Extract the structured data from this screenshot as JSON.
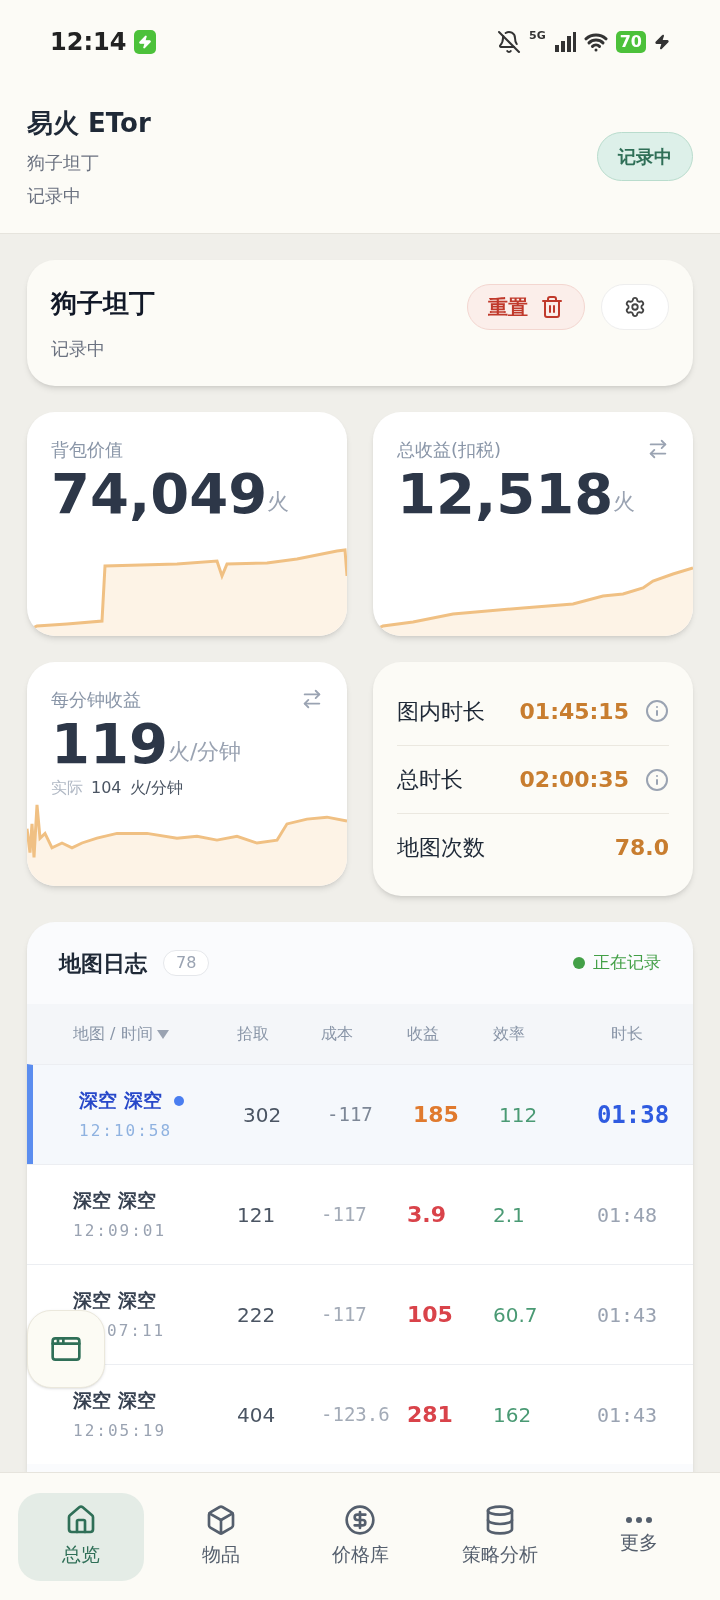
{
  "status_bar": {
    "time": "12:14",
    "network": "5G",
    "battery": "70"
  },
  "header": {
    "title": "易火 ETor",
    "subtitle": "狗子坦丁",
    "status": "记录中",
    "badge": "记录中"
  },
  "session": {
    "name": "狗子坦丁",
    "status": "记录中",
    "reset_button": "重置"
  },
  "stats": [
    {
      "kind": "sparkline",
      "label": "背包价值",
      "value": "74,049",
      "unit": "火",
      "swap": false
    },
    {
      "kind": "sparkline",
      "label": "总收益(扣税)",
      "value": "12,518",
      "unit": "火",
      "swap": true
    },
    {
      "kind": "rate",
      "label": "每分钟收益",
      "value": "119",
      "unit": "火/分钟",
      "swap": true,
      "actual_label": "实际",
      "actual_value": "104",
      "actual_unit": "火/分钟"
    }
  ],
  "times": [
    {
      "label": "图内时长",
      "value": "01:45:15",
      "info": true
    },
    {
      "label": "总时长",
      "value": "02:00:35",
      "info": true
    },
    {
      "label": "地图次数",
      "value": "78.0",
      "info": false
    }
  ],
  "map_log": {
    "title": "地图日志",
    "count": "78",
    "recording": "正在记录",
    "columns": [
      "地图 / 时间",
      "拾取",
      "成本",
      "收益",
      "效率",
      "时长"
    ],
    "rows": [
      {
        "map": "深空 深空",
        "time": "12:10:58",
        "covered": false,
        "pickup": "302",
        "cost": "-117",
        "income": "185",
        "efficiency": "112",
        "duration": "01:38",
        "selected": true
      },
      {
        "map": "深空 深空",
        "time": "12:09:01",
        "covered": false,
        "pickup": "121",
        "cost": "-117",
        "income": "3.9",
        "efficiency": "2.1",
        "duration": "01:48",
        "selected": false
      },
      {
        "map": "深空 深空",
        "time": "07:11",
        "covered": true,
        "pickup": "222",
        "cost": "-117",
        "income": "105",
        "efficiency": "60.7",
        "duration": "01:43",
        "selected": false
      },
      {
        "map": "深空 深空",
        "time": "12:05:19",
        "covered": false,
        "pickup": "404",
        "cost": "-123.6",
        "income": "281",
        "efficiency": "162",
        "duration": "01:43",
        "selected": false
      }
    ]
  },
  "nav": [
    {
      "label": "总览",
      "selected": true
    },
    {
      "label": "物品",
      "selected": false
    },
    {
      "label": "价格库",
      "selected": false
    },
    {
      "label": "策略分析",
      "selected": false
    },
    {
      "label": "更多",
      "selected": false
    }
  ]
}
